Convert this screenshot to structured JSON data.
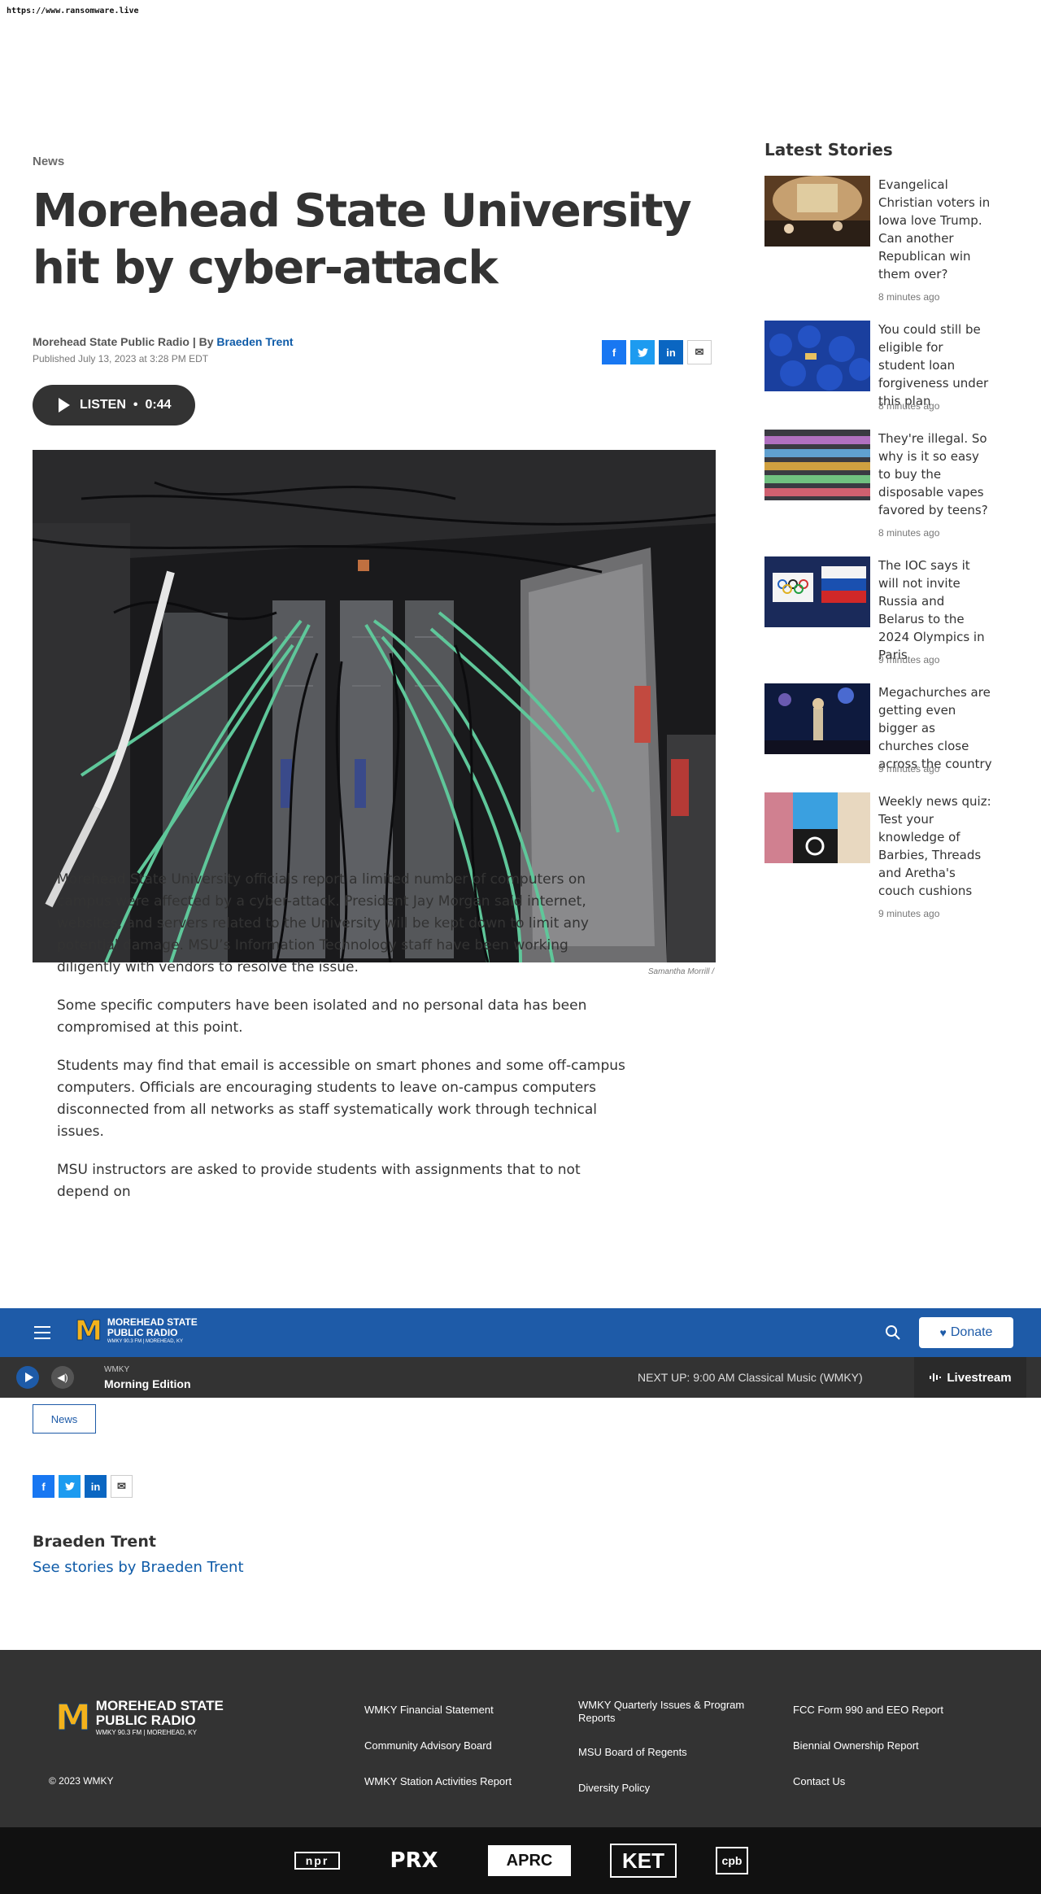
{
  "url": "https://www.ransomware.live",
  "article": {
    "category": "News",
    "headline": "Morehead State University hit by cyber-attack",
    "source": "Morehead State Public Radio | By",
    "author": "Braeden Trent",
    "published": "Published July 13, 2023 at 3:28 PM EDT",
    "listen_label": "LISTEN",
    "listen_sep": "•",
    "listen_duration": "0:44",
    "photo_credit": "Samantha Morrill  /",
    "paragraphs": [
      "Morehead State University officials report a limited number of computers on campus were affected by a cyber-attack. President Jay Morgan said internet, websites, and servers related to the University will be kept down to limit any potential damage. MSU’s Information Technology staff have been working diligently with vendors to resolve the issue.",
      "Some specific computers have been isolated and no personal data has been compromised at this point.",
      "Students may find that email is accessible on smart phones and some off-campus computers. Officials are encouraging students to leave on-campus computers disconnected from all networks as staff systematically work through technical issues.",
      "MSU instructors are asked to provide students with assignments that to not depend on"
    ],
    "tag": "News",
    "author_name": "Braeden Trent",
    "author_link": "See stories by Braeden Trent"
  },
  "share": {
    "facebook": "f",
    "twitter": "t",
    "linkedin": "in",
    "email": "✉"
  },
  "sidebar": {
    "heading": "Latest Stories",
    "stories": [
      {
        "title": "Evangelical Christian voters in Iowa love Trump. Can another Republican win them over?",
        "time": "8 minutes ago"
      },
      {
        "title": "You could still be eligible for student loan forgiveness under this plan",
        "time": "8 minutes ago"
      },
      {
        "title": "They're illegal. So why is it so easy to buy the disposable vapes favored by teens?",
        "time": "8 minutes ago"
      },
      {
        "title": "The IOC says it will not invite Russia and Belarus to the 2024 Olympics in Paris",
        "time": "9 minutes ago"
      },
      {
        "title": "Megachurches are getting even bigger as churches close across the country",
        "time": "9 minutes ago"
      },
      {
        "title": "Weekly news quiz: Test your knowledge of Barbies, Threads and Aretha's couch cushions",
        "time": "9 minutes ago"
      }
    ]
  },
  "nav": {
    "logo_m": "M",
    "logo_line1": "MOREHEAD STATE",
    "logo_line2": "PUBLIC RADIO",
    "logo_line3": "WMKY 90.3 FM  |  MOREHEAD, KY",
    "donate": "Donate"
  },
  "player": {
    "station": "WMKY",
    "program": "Morning Edition",
    "next_up": "NEXT UP: 9:00 AM Classical Music (WMKY)",
    "livestream": "Livestream"
  },
  "footer": {
    "copyright": "© 2023 WMKY",
    "links": {
      "financial": "WMKY Financial Statement",
      "advisory": "Community Advisory Board",
      "activities": "WMKY Station Activities Report",
      "quarterly": "WMKY Quarterly Issues & Program Reports",
      "regents": "MSU Board of Regents",
      "diversity": "Diversity Policy",
      "fcc": "FCC Form 990 and EEO Report",
      "biennial": "Biennial Ownership Report",
      "contact": "Contact Us"
    },
    "partners": [
      "npr",
      "PRX",
      "APRC",
      "KET",
      "cpb"
    ]
  },
  "colors": {
    "brand_blue": "#1e5ba8",
    "link_blue": "#0e5ba8",
    "gold": "#f2b21c",
    "dark": "#333333"
  }
}
